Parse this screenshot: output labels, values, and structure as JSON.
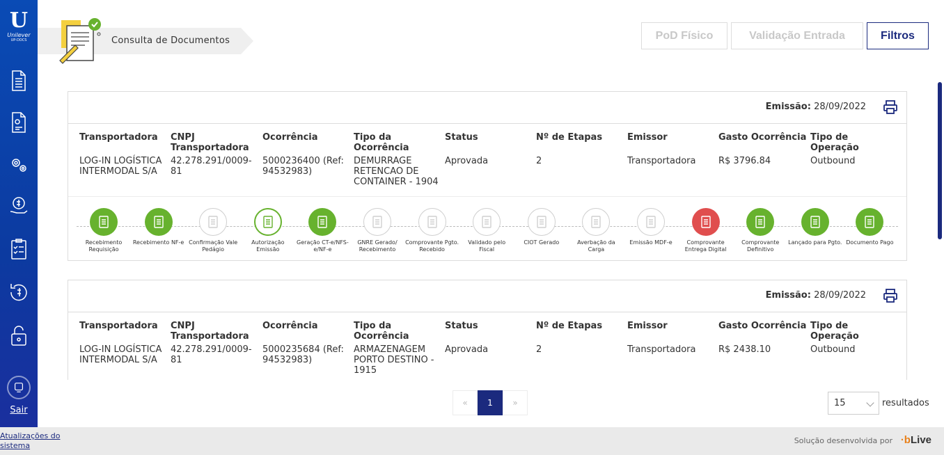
{
  "sidebar": {
    "logo_mark": "U",
    "logo_brand": "Unilever",
    "logo_sub": "UP-DOCS",
    "items": [
      {
        "name": "document-icon"
      },
      {
        "name": "document-settings-icon"
      },
      {
        "name": "gears-icon"
      },
      {
        "name": "money-hand-icon"
      },
      {
        "name": "checklist-icon"
      },
      {
        "name": "refund-icon"
      },
      {
        "name": "lock-icon"
      }
    ],
    "logout_label": "Sair"
  },
  "breadcrumb": {
    "label": "Consulta de Documentos"
  },
  "toolbar": {
    "pod_label": "PoD Físico",
    "validacao_label": "Validação Entrada",
    "filtros_label": "Filtros"
  },
  "colors": {
    "accent": "#1b2a7e",
    "success": "#67b22e",
    "error": "#e04e4e",
    "sidebar": "#0c3aa0"
  },
  "headers": [
    "Transportadora",
    "CNPJ Transportadora",
    "Ocorrência",
    "Tipo da Ocorrência",
    "Status",
    "Nº de Etapas",
    "Emissor",
    "Gasto Ocorrência",
    "Tipo de Operação"
  ],
  "cards": [
    {
      "emissao_label": "Emissão:",
      "emissao_date": "28/09/2022",
      "values": [
        "LOG-IN LOGÍSTICA INTERMODAL S/A",
        "42.278.291/0009-81",
        "5000236400 (Ref: 94532983)",
        "DEMURRAGE RETENCAO DE CONTAINER - 1904",
        "Aprovada",
        "2",
        "Transportadora",
        "R$ 3796.84",
        "Outbound"
      ]
    },
    {
      "emissao_label": "Emissão:",
      "emissao_date": "28/09/2022",
      "values": [
        "LOG-IN LOGÍSTICA INTERMODAL S/A",
        "42.278.291/0009-81",
        "5000235684 (Ref: 94532983)",
        "ARMAZENAGEM PORTO DESTINO - 1915",
        "Aprovada",
        "2",
        "Transportadora",
        "R$ 2438.10",
        "Outbound"
      ]
    }
  ],
  "steps": [
    {
      "label": "Recebimento Requisição",
      "state": "done"
    },
    {
      "label": "Recebimento NF-e",
      "state": "done"
    },
    {
      "label": "Confirmação Vale Pedágio",
      "state": "todo"
    },
    {
      "label": "Autorização Emissão",
      "state": "cur"
    },
    {
      "label": "Geração CT-e/NFS-e/NF-e",
      "state": "done"
    },
    {
      "label": "GNRE Gerado/ Recebimento",
      "state": "todo"
    },
    {
      "label": "Comprovante Pgto. Recebido",
      "state": "todo"
    },
    {
      "label": "Validado pelo Fiscal",
      "state": "todo"
    },
    {
      "label": "CIOT Gerado",
      "state": "todo"
    },
    {
      "label": "Averbação da Carga",
      "state": "todo"
    },
    {
      "label": "Emissão MDF-e",
      "state": "todo"
    },
    {
      "label": "Comprovante Entrega Digital",
      "state": "err"
    },
    {
      "label": "Comprovante Definitivo",
      "state": "done"
    },
    {
      "label": "Lançado para Pgto.",
      "state": "done"
    },
    {
      "label": "Documento Pago",
      "state": "done"
    }
  ],
  "pagination": {
    "prev": "«",
    "current": "1",
    "next": "»"
  },
  "page_size": {
    "value": "15",
    "suffix": "resultados"
  },
  "footer": {
    "updates_label": "Atualizações do sistema",
    "solution_label": "Solução desenvolvida por",
    "brand_prefix": "·b",
    "brand_name": "Live"
  }
}
